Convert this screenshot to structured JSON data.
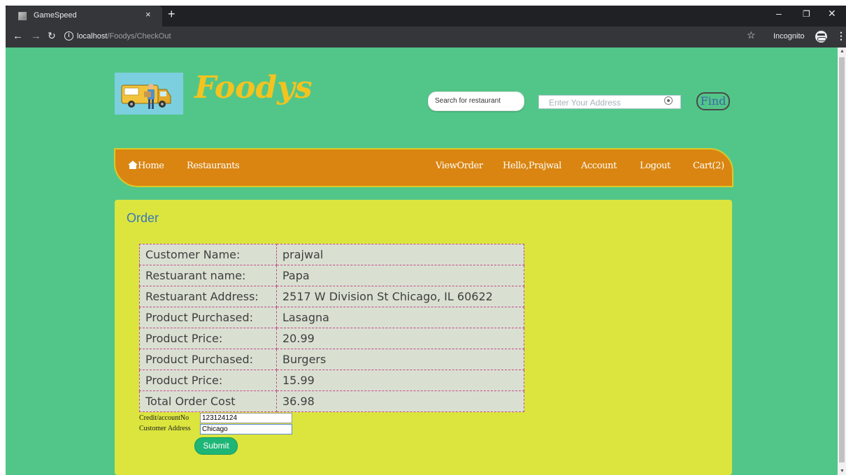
{
  "browser": {
    "tab_title": "GameSpeed",
    "tab_close": "×",
    "new_tab": "+",
    "url_host": "localhost",
    "url_path": "/Foodys/CheckOut",
    "incognito_label": "Incognito",
    "icons": [
      "back-icon",
      "forward-icon",
      "reload-icon",
      "info-icon",
      "star-icon",
      "incognito-icon",
      "menu-icon",
      "minimize-icon",
      "restore-icon",
      "close-icon"
    ]
  },
  "header": {
    "logo_text": "Foodys",
    "logo_color": "#f4c31f",
    "search_placeholder": "Search for restaurant",
    "address_placeholder": "Enter Your Address",
    "find_label": "Find"
  },
  "nav": {
    "home": "Home",
    "restaurants": "Restaurants",
    "view_order": "ViewOrder",
    "greeting": "Hello,Prajwal",
    "account": "Account",
    "logout": "Logout",
    "cart": "Cart(2)"
  },
  "order": {
    "title": "Order",
    "rows": [
      {
        "label": "Customer Name:",
        "value": "prajwal"
      },
      {
        "label": "Restuarant name:",
        "value": "Papa"
      },
      {
        "label": "Restuarant Address:",
        "value": "2517 W Division St Chicago, IL 60622"
      },
      {
        "label": "Product Purchased:",
        "value": "Lasagna"
      },
      {
        "label": "Product Price:",
        "value": "20.99"
      },
      {
        "label": "Product Purchased:",
        "value": "Burgers"
      },
      {
        "label": "Product Price:",
        "value": "15.99"
      },
      {
        "label": "Total Order Cost",
        "value": "36.98"
      }
    ],
    "credit_label": "Credit/accountNo",
    "credit_value": "123124124",
    "address_label": "Customer Address",
    "address_value": "Chicago",
    "submit_label": "Submit"
  },
  "colors": {
    "page_bg": "#52c688",
    "nav_bg": "#da8511",
    "panel_bg": "#dbe53e",
    "title_blue": "#3b77b9",
    "submit_bg": "#1eb676"
  }
}
